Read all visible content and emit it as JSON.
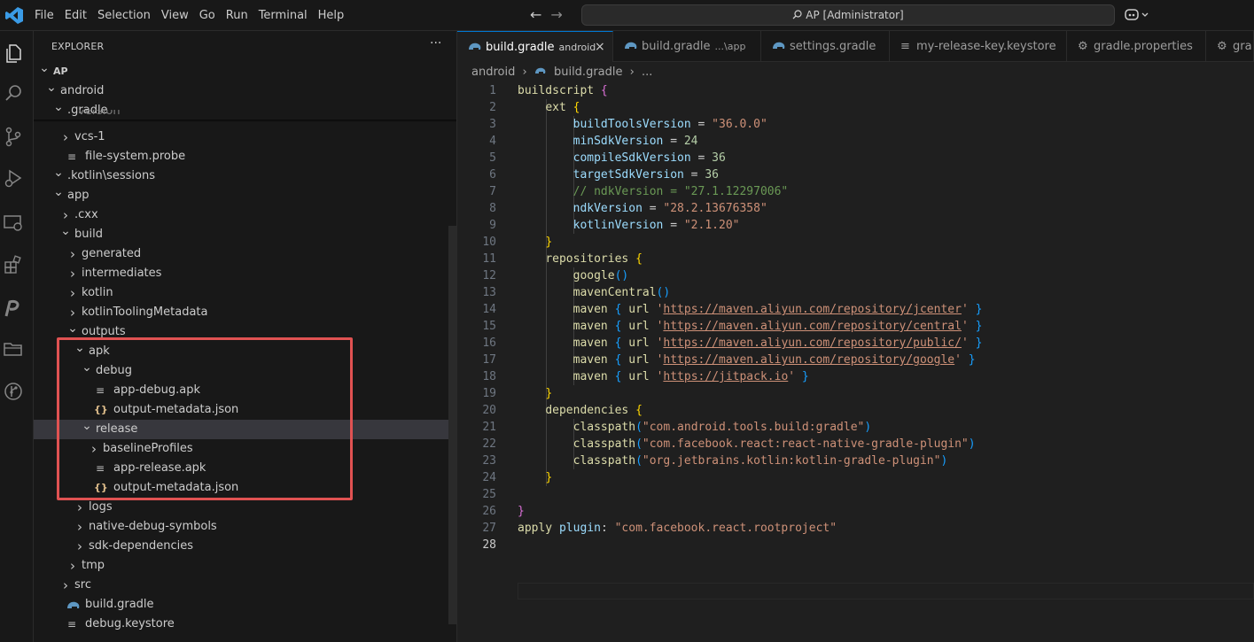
{
  "menu": [
    "File",
    "Edit",
    "Selection",
    "View",
    "Go",
    "Run",
    "Terminal",
    "Help"
  ],
  "command_center": {
    "text": "AP [Administrator]"
  },
  "explorer": {
    "title": "EXPLORER",
    "more": "···",
    "rows": [
      {
        "label": "AP",
        "chev": "v",
        "indent": 0,
        "icon": "",
        "bold": true
      },
      {
        "label": "android",
        "chev": "v",
        "indent": 1,
        "icon": ""
      },
      {
        "label": ".gradle",
        "chev": "v",
        "indent": 2,
        "icon": ""
      },
      {
        "label": "vcs-1",
        "chev": ">",
        "indent": 3,
        "icon": ""
      },
      {
        "label": "file-system.probe",
        "chev": "",
        "indent": 3,
        "icon": "≡"
      },
      {
        "label": ".kotlin\\sessions",
        "chev": "v",
        "indent": 2,
        "icon": ""
      },
      {
        "label": "app",
        "chev": "v",
        "indent": 2,
        "icon": ""
      },
      {
        "label": ".cxx",
        "chev": ">",
        "indent": 3,
        "icon": ""
      },
      {
        "label": "build",
        "chev": "v",
        "indent": 3,
        "icon": ""
      },
      {
        "label": "generated",
        "chev": ">",
        "indent": 4,
        "icon": ""
      },
      {
        "label": "intermediates",
        "chev": ">",
        "indent": 4,
        "icon": ""
      },
      {
        "label": "kotlin",
        "chev": ">",
        "indent": 4,
        "icon": ""
      },
      {
        "label": "kotlinToolingMetadata",
        "chev": ">",
        "indent": 4,
        "icon": ""
      },
      {
        "label": "outputs",
        "chev": "v",
        "indent": 4,
        "icon": ""
      },
      {
        "label": "apk",
        "chev": "v",
        "indent": 5,
        "icon": ""
      },
      {
        "label": "debug",
        "chev": "v",
        "indent": 6,
        "icon": ""
      },
      {
        "label": "app-debug.apk",
        "chev": "",
        "indent": 7,
        "icon": "≡"
      },
      {
        "label": "output-metadata.json",
        "chev": "",
        "indent": 7,
        "icon": "{}"
      },
      {
        "label": "release",
        "chev": "v",
        "indent": 6,
        "icon": "",
        "selected": true
      },
      {
        "label": "baselineProfiles",
        "chev": ">",
        "indent": 7,
        "icon": ""
      },
      {
        "label": "app-release.apk",
        "chev": "",
        "indent": 7,
        "icon": "≡"
      },
      {
        "label": "output-metadata.json",
        "chev": "",
        "indent": 7,
        "icon": "{}"
      },
      {
        "label": "logs",
        "chev": ">",
        "indent": 5,
        "icon": ""
      },
      {
        "label": "native-debug-symbols",
        "chev": ">",
        "indent": 5,
        "icon": ""
      },
      {
        "label": "sdk-dependencies",
        "chev": ">",
        "indent": 5,
        "icon": ""
      },
      {
        "label": "tmp",
        "chev": ">",
        "indent": 4,
        "icon": ""
      },
      {
        "label": "src",
        "chev": ">",
        "indent": 3,
        "icon": ""
      },
      {
        "label": "build.gradle",
        "chev": "",
        "indent": 3,
        "icon": "gradle"
      },
      {
        "label": "debug.keystore",
        "chev": "",
        "indent": 3,
        "icon": "≡"
      }
    ],
    "peek_label": "version"
  },
  "tabs": [
    {
      "label": "build.gradle",
      "desc": "android",
      "icon": "gradle",
      "active": true,
      "close": "×"
    },
    {
      "label": "build.gradle",
      "desc": "...\\app",
      "icon": "gradle"
    },
    {
      "label": "settings.gradle",
      "desc": "",
      "icon": "gradle"
    },
    {
      "label": "my-release-key.keystore",
      "desc": "",
      "icon": "≡"
    },
    {
      "label": "gradle.properties",
      "desc": "",
      "icon": "⚙"
    },
    {
      "label": "gra",
      "desc": "",
      "icon": "⚙"
    }
  ],
  "breadcrumb": {
    "folder": "android",
    "file": "build.gradle",
    "rest": "..."
  },
  "code": {
    "line_numbers": [
      "1",
      "2",
      "3",
      "4",
      "5",
      "6",
      "7",
      "8",
      "9",
      "10",
      "11",
      "12",
      "13",
      "14",
      "15",
      "16",
      "17",
      "18",
      "19",
      "20",
      "21",
      "22",
      "23",
      "24",
      "25",
      "26",
      "27",
      "28"
    ],
    "current_line": 28,
    "lines": [
      [
        {
          "t": "buildscript ",
          "c": "k"
        },
        {
          "t": "{",
          "c": "b1"
        }
      ],
      [
        {
          "t": "    "
        },
        {
          "t": "ext ",
          "c": "k"
        },
        {
          "t": "{",
          "c": "b2"
        }
      ],
      [
        {
          "t": "        "
        },
        {
          "t": "buildToolsVersion",
          "c": "v"
        },
        {
          "t": " = "
        },
        {
          "t": "\"36.0.0\"",
          "c": "s"
        }
      ],
      [
        {
          "t": "        "
        },
        {
          "t": "minSdkVersion",
          "c": "v"
        },
        {
          "t": " = "
        },
        {
          "t": "24",
          "c": "n"
        }
      ],
      [
        {
          "t": "        "
        },
        {
          "t": "compileSdkVersion",
          "c": "v"
        },
        {
          "t": " = "
        },
        {
          "t": "36",
          "c": "n"
        }
      ],
      [
        {
          "t": "        "
        },
        {
          "t": "targetSdkVersion",
          "c": "v"
        },
        {
          "t": " = "
        },
        {
          "t": "36",
          "c": "n"
        }
      ],
      [
        {
          "t": "        "
        },
        {
          "t": "// ndkVersion = \"27.1.12297006\"",
          "c": "c"
        }
      ],
      [
        {
          "t": "        "
        },
        {
          "t": "ndkVersion",
          "c": "v"
        },
        {
          "t": " = "
        },
        {
          "t": "\"28.2.13676358\"",
          "c": "s"
        }
      ],
      [
        {
          "t": "        "
        },
        {
          "t": "kotlinVersion",
          "c": "v"
        },
        {
          "t": " = "
        },
        {
          "t": "\"2.1.20\"",
          "c": "s"
        }
      ],
      [
        {
          "t": "    "
        },
        {
          "t": "}",
          "c": "b2"
        }
      ],
      [
        {
          "t": "    "
        },
        {
          "t": "repositories ",
          "c": "k"
        },
        {
          "t": "{",
          "c": "b2"
        }
      ],
      [
        {
          "t": "        "
        },
        {
          "t": "google",
          "c": "k"
        },
        {
          "t": "()",
          "c": "b3"
        }
      ],
      [
        {
          "t": "        "
        },
        {
          "t": "mavenCentral",
          "c": "k"
        },
        {
          "t": "()",
          "c": "b3"
        }
      ],
      [
        {
          "t": "        "
        },
        {
          "t": "maven ",
          "c": "k"
        },
        {
          "t": "{ ",
          "c": "b3"
        },
        {
          "t": "url ",
          "c": "k"
        },
        {
          "t": "'",
          "c": "s"
        },
        {
          "t": "https://maven.aliyun.com/repository/jcenter",
          "c": "u"
        },
        {
          "t": "'",
          "c": "s"
        },
        {
          "t": " }",
          "c": "b3"
        }
      ],
      [
        {
          "t": "        "
        },
        {
          "t": "maven ",
          "c": "k"
        },
        {
          "t": "{ ",
          "c": "b3"
        },
        {
          "t": "url ",
          "c": "k"
        },
        {
          "t": "'",
          "c": "s"
        },
        {
          "t": "https://maven.aliyun.com/repository/central",
          "c": "u"
        },
        {
          "t": "'",
          "c": "s"
        },
        {
          "t": " }",
          "c": "b3"
        }
      ],
      [
        {
          "t": "        "
        },
        {
          "t": "maven ",
          "c": "k"
        },
        {
          "t": "{ ",
          "c": "b3"
        },
        {
          "t": "url ",
          "c": "k"
        },
        {
          "t": "'",
          "c": "s"
        },
        {
          "t": "https://maven.aliyun.com/repository/public/",
          "c": "u"
        },
        {
          "t": "'",
          "c": "s"
        },
        {
          "t": " }",
          "c": "b3"
        }
      ],
      [
        {
          "t": "        "
        },
        {
          "t": "maven ",
          "c": "k"
        },
        {
          "t": "{ ",
          "c": "b3"
        },
        {
          "t": "url ",
          "c": "k"
        },
        {
          "t": "'",
          "c": "s"
        },
        {
          "t": "https://maven.aliyun.com/repository/google",
          "c": "u"
        },
        {
          "t": "'",
          "c": "s"
        },
        {
          "t": " }",
          "c": "b3"
        }
      ],
      [
        {
          "t": "        "
        },
        {
          "t": "maven ",
          "c": "k"
        },
        {
          "t": "{ ",
          "c": "b3"
        },
        {
          "t": "url ",
          "c": "k"
        },
        {
          "t": "'",
          "c": "s"
        },
        {
          "t": "https://jitpack.io",
          "c": "u"
        },
        {
          "t": "'",
          "c": "s"
        },
        {
          "t": " }",
          "c": "b3"
        }
      ],
      [
        {
          "t": "    "
        },
        {
          "t": "}",
          "c": "b2"
        }
      ],
      [
        {
          "t": "    "
        },
        {
          "t": "dependencies ",
          "c": "k"
        },
        {
          "t": "{",
          "c": "b2"
        }
      ],
      [
        {
          "t": "        "
        },
        {
          "t": "classpath",
          "c": "k"
        },
        {
          "t": "(",
          "c": "b3"
        },
        {
          "t": "\"com.android.tools.build:gradle\"",
          "c": "s"
        },
        {
          "t": ")",
          "c": "b3"
        }
      ],
      [
        {
          "t": "        "
        },
        {
          "t": "classpath",
          "c": "k"
        },
        {
          "t": "(",
          "c": "b3"
        },
        {
          "t": "\"com.facebook.react:react-native-gradle-plugin\"",
          "c": "s"
        },
        {
          "t": ")",
          "c": "b3"
        }
      ],
      [
        {
          "t": "        "
        },
        {
          "t": "classpath",
          "c": "k"
        },
        {
          "t": "(",
          "c": "b3"
        },
        {
          "t": "\"org.jetbrains.kotlin:kotlin-gradle-plugin\"",
          "c": "s"
        },
        {
          "t": ")",
          "c": "b3"
        }
      ],
      [
        {
          "t": "    "
        },
        {
          "t": "}",
          "c": "b2"
        }
      ],
      [
        {
          "t": ""
        }
      ],
      [
        {
          "t": "}",
          "c": "b1"
        }
      ],
      [
        {
          "t": "apply ",
          "c": "k"
        },
        {
          "t": "plugin",
          "c": "v"
        },
        {
          "t": ": "
        },
        {
          "t": "\"com.facebook.react.rootproject\"",
          "c": "s"
        }
      ],
      [
        {
          "t": ""
        }
      ]
    ]
  },
  "colors": {
    "accent": "#0078d4",
    "highlight_box": "#e05252"
  }
}
